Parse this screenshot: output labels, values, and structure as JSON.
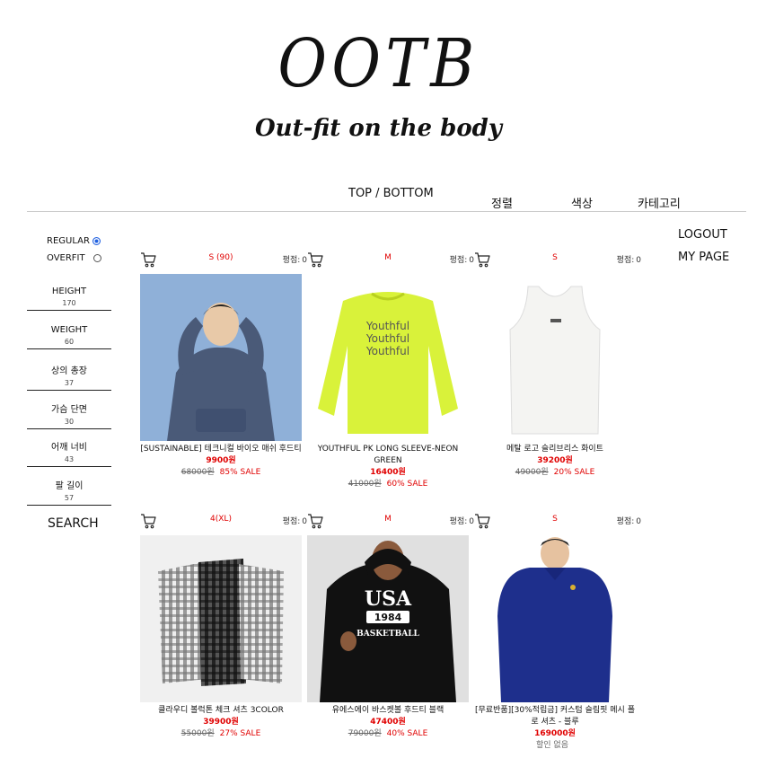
{
  "logo": {
    "main": "OOTB",
    "tagline": "Out-fit on the body"
  },
  "nav": {
    "top_bottom": "TOP / BOTTOM",
    "sort": "정렬",
    "color": "색상",
    "category": "카테고리"
  },
  "user": {
    "logout": "LOGOUT",
    "mypage": "MY PAGE"
  },
  "fit": {
    "regular": "REGULAR",
    "overfit": "OVERFIT",
    "selected": "REGULAR"
  },
  "filters": [
    {
      "label": "HEIGHT",
      "value": "170"
    },
    {
      "label": "WEIGHT",
      "value": "60"
    },
    {
      "label": "상의 총장",
      "value": "37"
    },
    {
      "label": "가슴 단면",
      "value": "30"
    },
    {
      "label": "어깨 너비",
      "value": "43"
    },
    {
      "label": "팔 길이",
      "value": "57"
    }
  ],
  "search_label": "SEARCH",
  "rating_label": "평점:",
  "products": [
    {
      "size": "S (90)",
      "rating": "0",
      "name": "[SUSTAINABLE] 테크니컬 바이오 매쉬 후드티",
      "price": "9900원",
      "orig": "68000원",
      "sale": "85% SALE"
    },
    {
      "size": "M",
      "rating": "0",
      "name": "YOUTHFUL PK LONG SLEEVE-NEON GREEN",
      "price": "16400원",
      "orig": "41000원",
      "sale": "60% SALE"
    },
    {
      "size": "S",
      "rating": "0",
      "name": "메탈 로고 슬리브리스 화이트",
      "price": "39200원",
      "orig": "49000원",
      "sale": "20% SALE"
    },
    {
      "size": "4(XL)",
      "rating": "0",
      "name": "클라우디 볼럭톤 체크 셔츠 3COLOR",
      "price": "39900원",
      "orig": "55000원",
      "sale": "27% SALE"
    },
    {
      "size": "M",
      "rating": "0",
      "name": "유에스에이 바스켓볼 후드티 블랙",
      "price": "47400원",
      "orig": "79000원",
      "sale": "40% SALE"
    },
    {
      "size": "S",
      "rating": "0",
      "name": "[무료반품][30%적립금] 커스텀 슬림핏 메시 폴로 셔츠 - 블루",
      "price": "169000원",
      "orig": "할인 없음",
      "sale": ""
    }
  ],
  "image_text": {
    "usa": "USA",
    "year": "1984",
    "basketball": "BASKETBALL",
    "youthful": "Youthful"
  },
  "colors": {
    "accent_red": "#e00000",
    "radio_blue": "#2060e0"
  }
}
